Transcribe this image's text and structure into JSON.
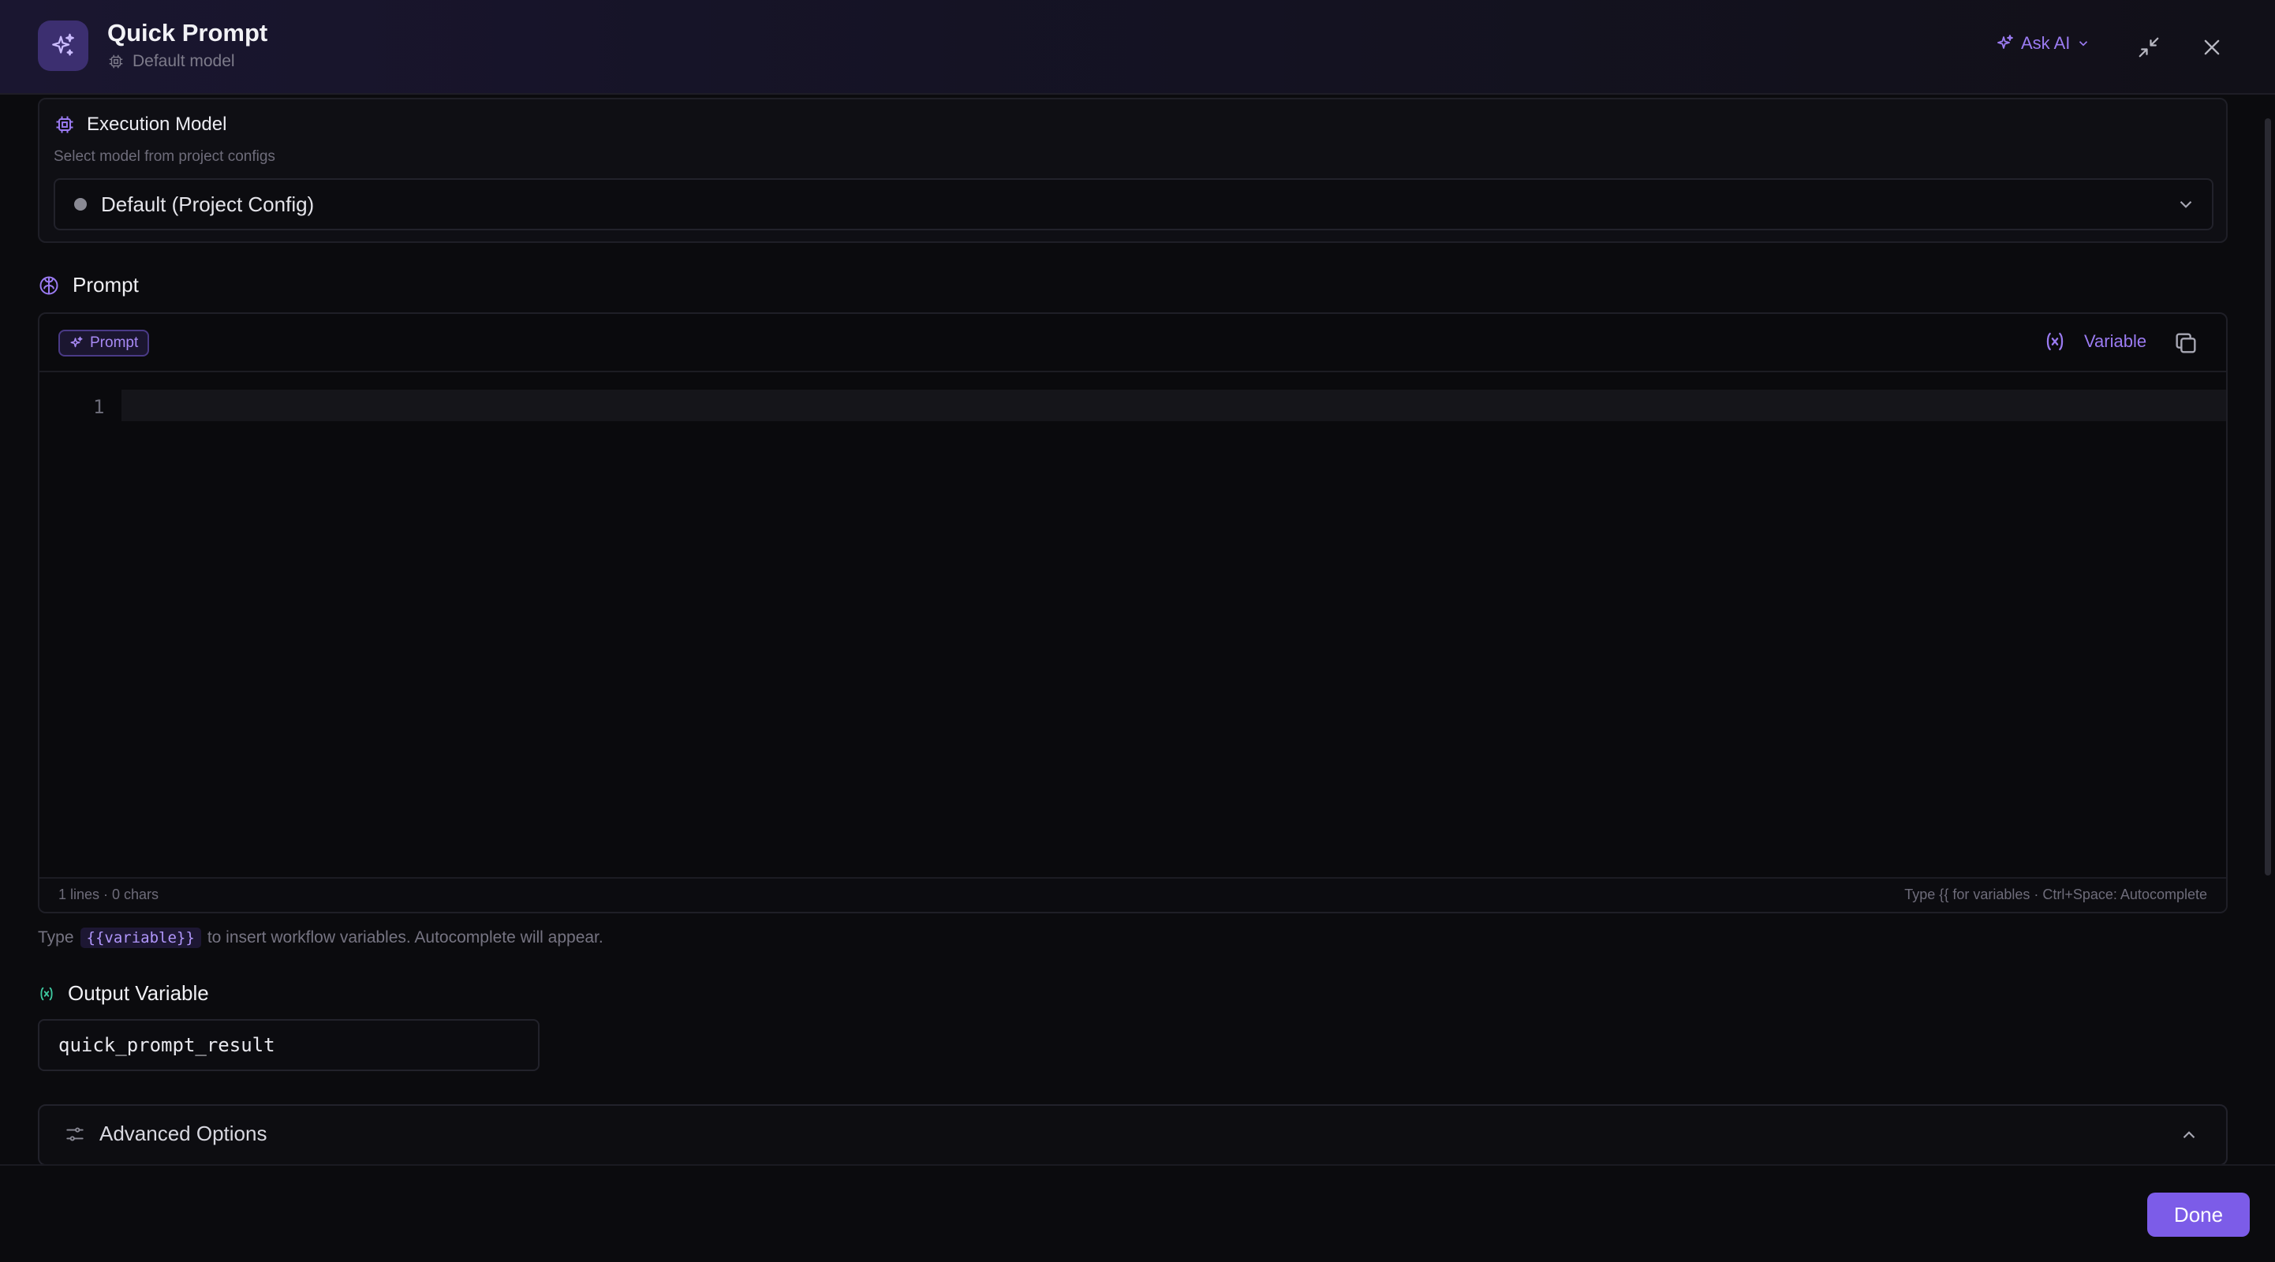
{
  "header": {
    "title": "Quick Prompt",
    "subtitle": "Default model",
    "ask_ai_label": "Ask AI"
  },
  "execution_model": {
    "heading": "Execution Model",
    "description": "Select model from project configs",
    "selected": "Default (Project Config)"
  },
  "prompt": {
    "heading": "Prompt",
    "badge": "Prompt",
    "variable_button": "Variable",
    "line_number": "1",
    "footer_left": "1 lines · 0 chars",
    "footer_right": "Type {{ for variables · Ctrl+Space: Autocomplete"
  },
  "hint": {
    "prefix": "Type",
    "code": "{{variable}}",
    "suffix": "to insert workflow variables. Autocomplete will appear."
  },
  "output_variable": {
    "heading": "Output Variable",
    "value": "quick_prompt_result"
  },
  "advanced": {
    "label": "Advanced Options"
  },
  "footer": {
    "done_label": "Done"
  },
  "colors": {
    "accent": "#7c5ce8",
    "accent_text": "#9b7bf2",
    "background": "#0b0b0e",
    "output_icon": "#3ec9a0"
  },
  "icons": {
    "app": "sparkles-icon",
    "model": "cpu-chip-icon",
    "prompt": "brain-icon",
    "variable": "function-variable-icon",
    "copy": "copy-icon",
    "advanced": "sliders-icon",
    "minimize": "minimize-icon",
    "close": "close-icon"
  }
}
